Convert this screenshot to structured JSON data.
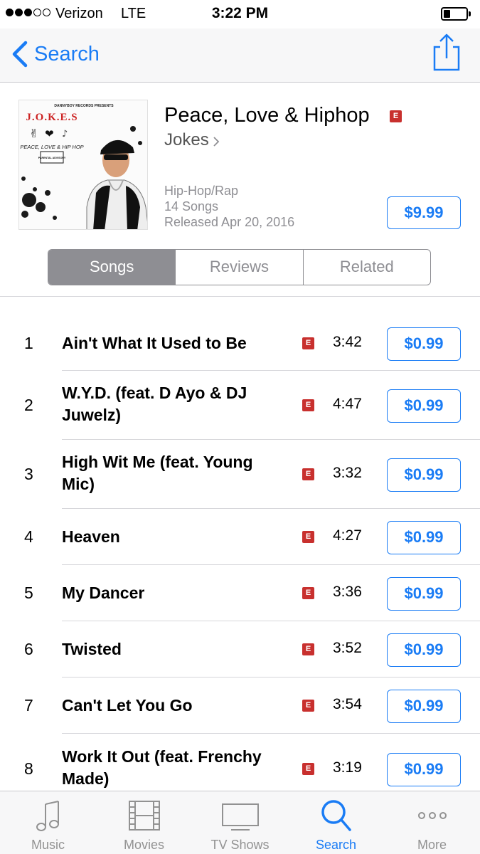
{
  "status_bar": {
    "carrier": "Verizon",
    "network": "LTE",
    "time": "3:22 PM",
    "signal_strength": 3,
    "battery_level": 0.3
  },
  "nav": {
    "back_label": "Search",
    "share_icon": "share-icon"
  },
  "album": {
    "title": "Peace, Love & Hiphop",
    "explicit": "E",
    "artist": "Jokes",
    "genre": "Hip-Hop/Rap",
    "song_count": "14 Songs",
    "released": "Released Apr 20, 2016",
    "price": "$9.99",
    "art": {
      "label": "DANNYBOY RECORDS PRESENTS",
      "name": "J.O.K.E.S",
      "subtitle": "PEACE, LOVE & HIP HOP",
      "advisory": "PARENTAL ADVISORY"
    }
  },
  "segments": [
    "Songs",
    "Reviews",
    "Related"
  ],
  "active_segment": "Songs",
  "tracks": [
    {
      "num": "1",
      "title": "Ain't What It Used to Be",
      "explicit": "E",
      "time": "3:42",
      "price": "$0.99"
    },
    {
      "num": "2",
      "title": "W.Y.D. (feat. D Ayo & DJ Juwelz)",
      "explicit": "E",
      "time": "4:47",
      "price": "$0.99"
    },
    {
      "num": "3",
      "title": "High Wit Me (feat. Young Mic)",
      "explicit": "E",
      "time": "3:32",
      "price": "$0.99"
    },
    {
      "num": "4",
      "title": "Heaven",
      "explicit": "E",
      "time": "4:27",
      "price": "$0.99"
    },
    {
      "num": "5",
      "title": "My Dancer",
      "explicit": "E",
      "time": "3:36",
      "price": "$0.99"
    },
    {
      "num": "6",
      "title": "Twisted",
      "explicit": "E",
      "time": "3:52",
      "price": "$0.99"
    },
    {
      "num": "7",
      "title": "Can't Let You Go",
      "explicit": "E",
      "time": "3:54",
      "price": "$0.99"
    },
    {
      "num": "8",
      "title": "Work It Out (feat. Frenchy Made)",
      "explicit": "E",
      "time": "3:19",
      "price": "$0.99"
    }
  ],
  "tab_bar": {
    "active": "Search",
    "tabs": [
      {
        "label": "Music",
        "icon": "music-note-icon"
      },
      {
        "label": "Movies",
        "icon": "film-icon"
      },
      {
        "label": "TV Shows",
        "icon": "tv-icon"
      },
      {
        "label": "Search",
        "icon": "search-icon"
      },
      {
        "label": "More",
        "icon": "more-icon"
      }
    ]
  },
  "colors": {
    "accent": "#1a7cf5",
    "explicit_badge": "#c8302e",
    "inactive": "#929292"
  }
}
